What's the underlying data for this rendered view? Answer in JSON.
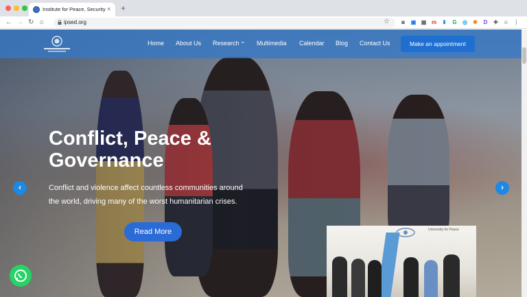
{
  "browser": {
    "tab_title": "Institute for Peace, Security &",
    "tab_close": "×",
    "new_tab": "+",
    "url": "ipsed.org",
    "back": "←",
    "forward": "→",
    "reload": "↻",
    "home": "⌂",
    "bookmark": "☆",
    "extensions": [
      {
        "name": "camera-icon",
        "glyph": "◙",
        "color": "#5f6368"
      },
      {
        "name": "window-icon",
        "glyph": "▣",
        "color": "#1a73e8"
      },
      {
        "name": "grid-icon",
        "glyph": "▦",
        "color": "#5f6368"
      },
      {
        "name": "m-icon",
        "glyph": "m",
        "color": "#d93025"
      },
      {
        "name": "download-icon",
        "glyph": "⬇",
        "color": "#1a73e8"
      },
      {
        "name": "grammarly-icon",
        "glyph": "G",
        "color": "#15a34a"
      },
      {
        "name": "sync-icon",
        "glyph": "◎",
        "color": "#0b9ed9"
      },
      {
        "name": "star-ext-icon",
        "glyph": "✱",
        "color": "#ff7a00"
      },
      {
        "name": "d-icon",
        "glyph": "D",
        "color": "#7b3fe4"
      },
      {
        "name": "puzzle-icon",
        "glyph": "✚",
        "color": "#5f6368"
      },
      {
        "name": "profile-icon",
        "glyph": "☺",
        "color": "#5f6368"
      },
      {
        "name": "menu-icon",
        "glyph": "⋮",
        "color": "#5f6368"
      }
    ]
  },
  "nav": {
    "items": [
      "Home",
      "About Us",
      "Research",
      "Multimedia",
      "Calendar",
      "Blog",
      "Contact Us"
    ],
    "research_chevron": "⌄",
    "cta": "Make an appointment"
  },
  "hero": {
    "title": "Conflict, Peace & Governance",
    "subtitle": "Conflict and violence affect countless communities around the world, driving many of the worst humanitarian crises.",
    "button": "Read More",
    "prev": "‹",
    "next": "›"
  },
  "video": {
    "banner_text": "University for Peace"
  },
  "colors": {
    "nav_bg": "#3478c8",
    "cta_bg": "#1f6fd1",
    "read_more_bg": "#2b6bd6",
    "arrow_bg": "#1e88e5",
    "whatsapp_bg": "#25d366"
  }
}
